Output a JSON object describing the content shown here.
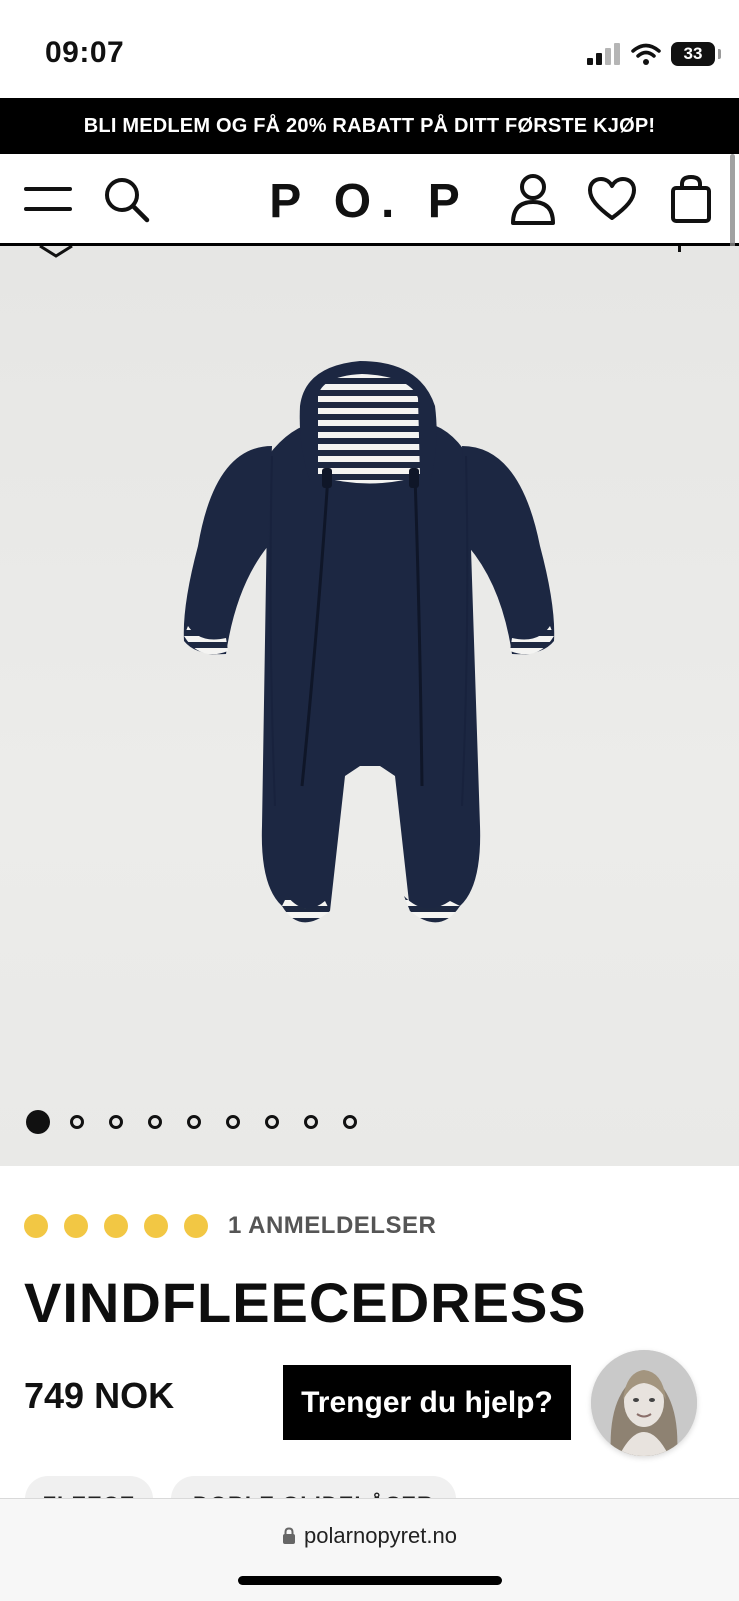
{
  "status_bar": {
    "time": "09:07",
    "battery": "33"
  },
  "promo": {
    "text": "BLI MEDLEM OG FÅ 20% RABATT PÅ DITT FØRSTE KJØP!"
  },
  "header": {
    "logo": "P O. P"
  },
  "product": {
    "image_alt": "Navy fleece baby overall with hood, double zippers and striped lining",
    "gallery_count": 9,
    "gallery_active_index": 0,
    "rating": 5,
    "reviews_label": "1 ANMELDELSER",
    "title": "VINDFLEECEDRESS",
    "price": "749 NOK",
    "tags": [
      "FLEECE",
      "DOBLE GLIDELÅSER"
    ]
  },
  "help": {
    "label": "Trenger du hjelp?"
  },
  "browser": {
    "url": "polarnopyret.no"
  },
  "colors": {
    "star": "#f2c744",
    "ink": "#111111",
    "garment": "#1c2742"
  }
}
